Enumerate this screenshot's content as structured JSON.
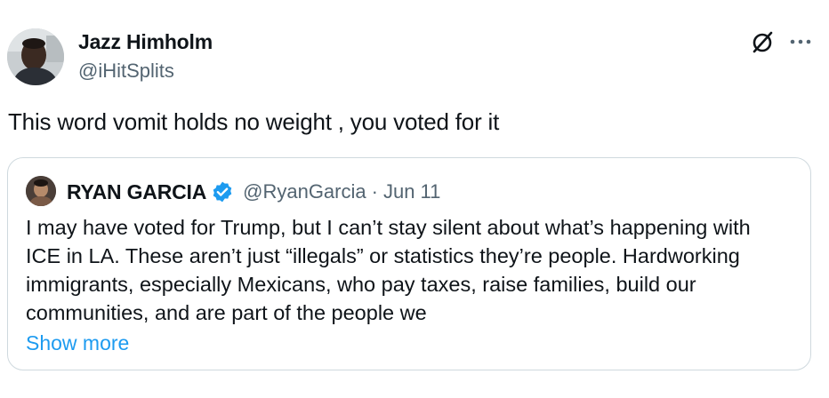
{
  "tweet": {
    "author": {
      "name": "Jazz Himholm",
      "handle": "@iHitSplits",
      "avatar_icon": "user-avatar"
    },
    "text": "This word vomit holds no weight , you voted for it",
    "header_icons": [
      "grok-icon",
      "more-options-icon"
    ]
  },
  "quote": {
    "author": {
      "name": "RYAN GARCIA",
      "verified": true,
      "handle": "@RyanGarcia",
      "separator": "·",
      "date": "Jun 11",
      "avatar_icon": "user-avatar"
    },
    "text_lines": [
      "I may have voted for Trump, but I can’t stay silent about what’s happening with",
      "ICE in LA. These aren’t just “illegals” or statistics they’re people. Hardworking",
      "immigrants, especially Mexicans, who pay taxes, raise families, build our",
      "communities, and are part of the people we"
    ],
    "show_more_label": "Show more"
  },
  "colors": {
    "text_primary": "#0f1419",
    "text_secondary": "#536471",
    "link_blue": "#1d9bf0",
    "verified_blue": "#1d9bf0",
    "card_border": "#cfd9de"
  }
}
